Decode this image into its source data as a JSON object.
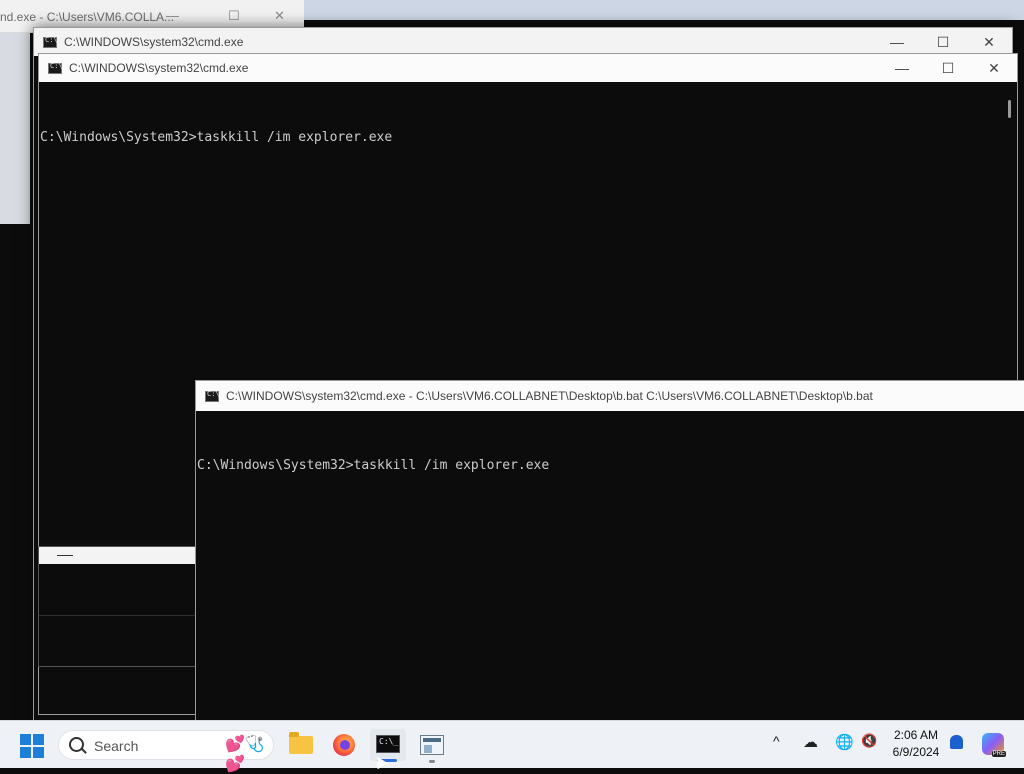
{
  "background_window": {
    "title": "nd.exe - C:\\Users\\VM6.COLLA..."
  },
  "window_back": {
    "title": "C:\\WINDOWS\\system32\\cmd.exe",
    "minimize": "—",
    "maximize": "☐",
    "close": "✕"
  },
  "window_middle": {
    "title": "C:\\WINDOWS\\system32\\cmd.exe",
    "minimize": "—",
    "maximize": "☐",
    "close": "✕",
    "console_lines": [
      "C:\\Windows\\System32>taskkill /im explorer.exe"
    ]
  },
  "window_front": {
    "title": "C:\\WINDOWS\\system32\\cmd.exe - C:\\Users\\VM6.COLLABNET\\Desktop\\b.bat   C:\\Users\\VM6.COLLABNET\\Desktop\\b.bat",
    "console_lines": [
      "C:\\Windows\\System32>taskkill /im explorer.exe"
    ]
  },
  "taskbar": {
    "search_label": "Search",
    "search_decoration": "💕🩺💕",
    "apps": [
      {
        "name": "File Explorer",
        "icon": "folder-icon"
      },
      {
        "name": "Firefox",
        "icon": "firefox-icon"
      },
      {
        "name": "Command Prompt",
        "icon": "terminal-icon",
        "active": true
      },
      {
        "name": "Window app",
        "icon": "window-app-icon"
      }
    ],
    "tray": {
      "chevron": "^",
      "time": "2:06 AM",
      "date": "6/9/2024",
      "copilot_badge": "PRE"
    }
  },
  "colors": {
    "console_bg": "#0c0c0c",
    "console_text": "#cccccc",
    "taskbar_bg": "#eef1f6",
    "accent": "#2b6fd6"
  }
}
